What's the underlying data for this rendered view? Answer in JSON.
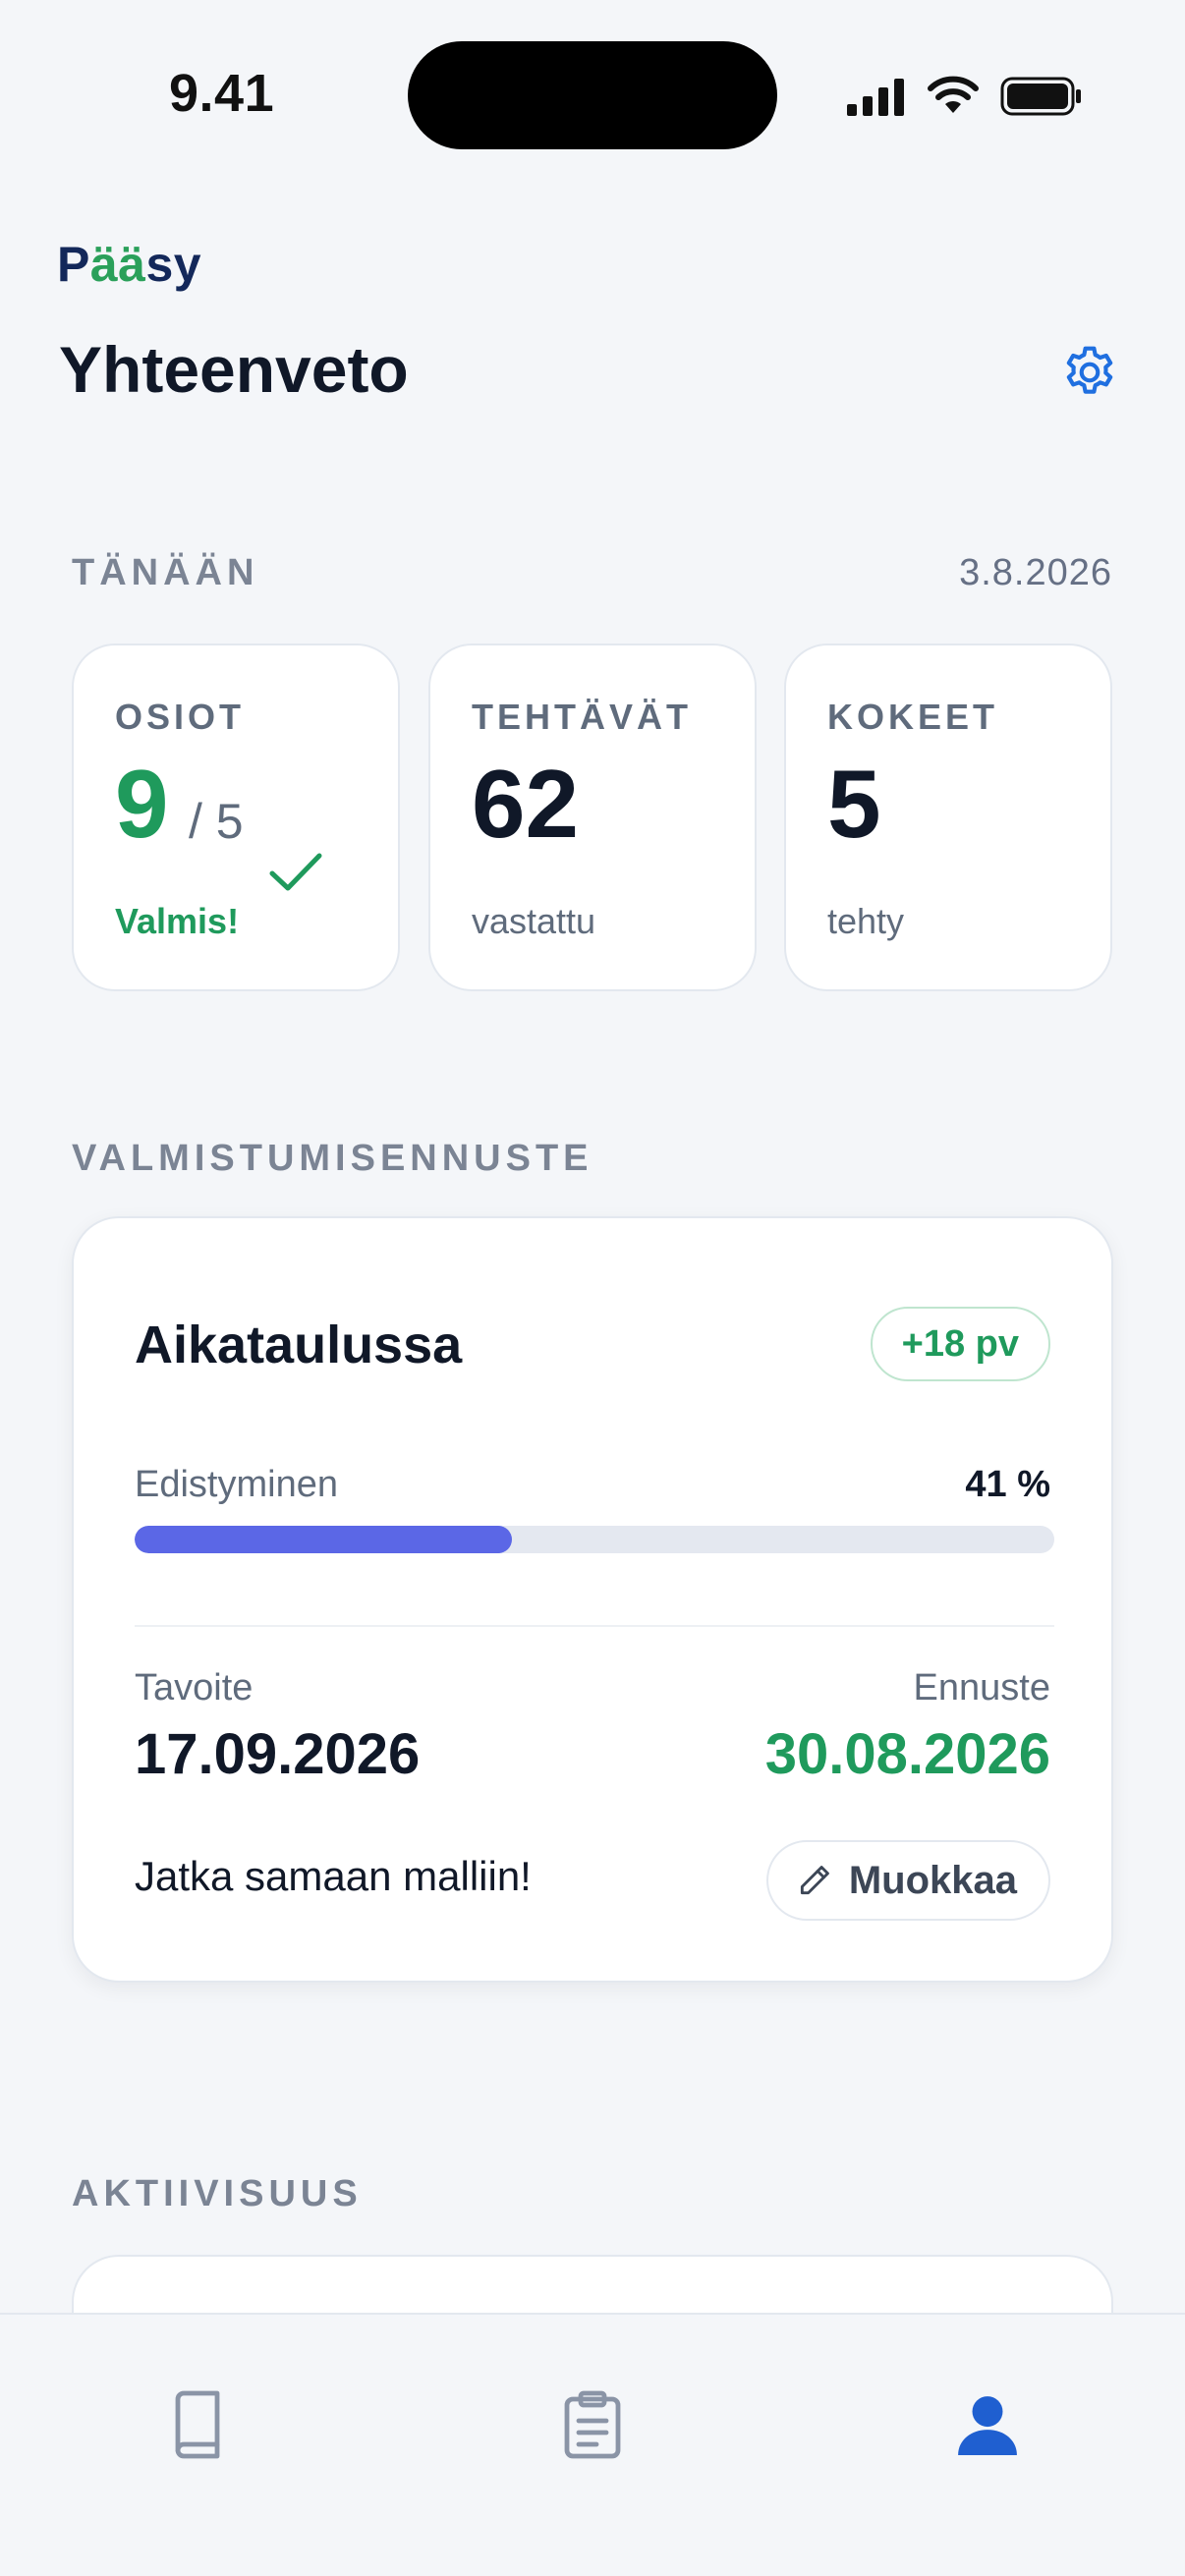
{
  "status_bar": {
    "time": "9.41"
  },
  "header": {
    "logo": "Pääsy",
    "title": "Yhteenveto"
  },
  "today": {
    "section_label": "TÄNÄÄN",
    "date": "3.8.2026",
    "cards": [
      {
        "label": "OSIOT",
        "value": "9",
        "of": "/ 5",
        "sub": "Valmis!"
      },
      {
        "label": "TEHTÄVÄT",
        "value": "62",
        "sub": "vastattu"
      },
      {
        "label": "KOKEET",
        "value": "5",
        "sub": "tehty"
      }
    ]
  },
  "forecast": {
    "section_label": "VALMISTUMISENNUSTE",
    "title": "Aikataulussa",
    "badge": "+18 pv",
    "progress_label": "Edistyminen",
    "progress_text": "41 %",
    "progress_fraction": 0.41,
    "goal_label": "Tavoite",
    "goal_date": "17.09.2026",
    "forecast_label": "Ennuste",
    "forecast_date": "30.08.2026",
    "message": "Jatka samaan malliin!",
    "edit_label": "Muokkaa"
  },
  "activity": {
    "section_label": "AKTIIVISUUS"
  },
  "tabbar": {
    "tabs": [
      {
        "icon": "book-icon",
        "active": false
      },
      {
        "icon": "clipboard-icon",
        "active": false
      },
      {
        "icon": "profile-icon",
        "active": true
      }
    ]
  },
  "colors": {
    "accent": "#1f6fe0",
    "success": "#1f9a5c",
    "progress": "#5b67e6"
  }
}
